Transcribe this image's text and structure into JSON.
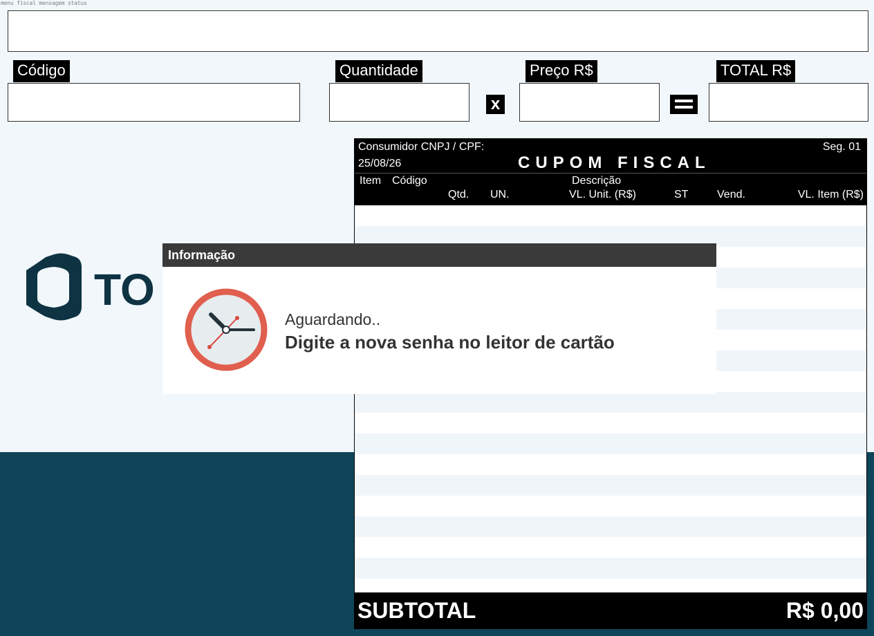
{
  "top_caption": "menu fiscal   mensagem   status",
  "fields": {
    "codigo_label": "Código",
    "quantidade_label": "Quantidade",
    "preco_label": "Preço R$",
    "total_label": "TOTAL R$",
    "multiply_symbol": "x",
    "equals_symbol": "="
  },
  "logo": {
    "text": "TO",
    "icon": "totvs-logo-icon"
  },
  "coupon": {
    "consumer_label": "Consumidor CNPJ / CPF:",
    "date": "25/08/26",
    "title": "CUPOM FISCAL",
    "seg": "Seg. 01",
    "columns": {
      "item": "Item",
      "codigo": "Código",
      "descricao": "Descrição",
      "qtd": "Qtd.",
      "un": "UN.",
      "vl_unit": "VL. Unit. (R$)",
      "st": "ST",
      "vend": "Vend.",
      "vl_item": "VL. Item (R$)"
    },
    "subtotal_label": "SUBTOTAL",
    "subtotal_value": "R$ 0,00"
  },
  "dialog": {
    "title": "Informação",
    "line1": "Aguardando..",
    "line2": "Digite a nova senha no leitor de cartão",
    "icon": "clock-icon"
  },
  "colors": {
    "background": "#f1f7fb",
    "band": "#0e4558",
    "logo": "#0e3342",
    "clock_ring": "#e05f4e",
    "dialog_title_bg": "#3a3a3a"
  }
}
